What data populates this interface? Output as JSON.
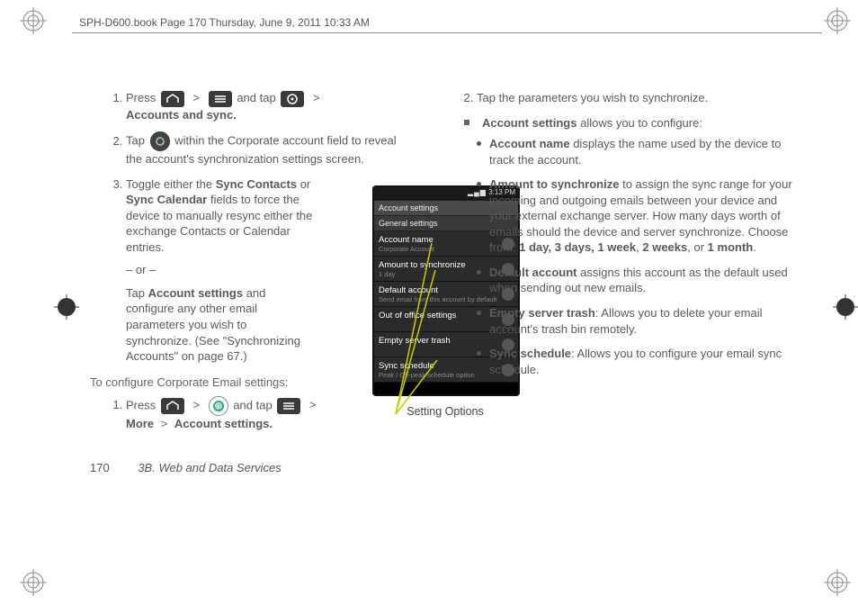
{
  "header": "SPH-D600.book  Page 170  Thursday, June 9, 2011  10:33 AM",
  "left": {
    "step1_a": "Press",
    "step1_b": "and tap",
    "step1_c": "Accounts and sync.",
    "step2_a": "Tap",
    "step2_b": "within the Corporate account field to reveal the account's synchronization settings screen.",
    "step3_a": "Toggle either the",
    "step3_sync_contacts": "Sync Contacts",
    "step3_or": "or",
    "step3_sync_calendar": "Sync Calendar",
    "step3_b": "fields to force the device to manually resync either the exchange Contacts or Calendar entries.",
    "or_sep": "– or –",
    "step3_c1": "Tap",
    "step3_acct_settings": "Account settings",
    "step3_c2": "and configure any other email parameters you wish to synchronize. (See \"Synchronizing Accounts\" on page 67.)",
    "subhead": "To configure Corporate Email settings:",
    "s1_a": "Press",
    "s1_b": "and tap",
    "s1_more": "More",
    "s1_gt": ">",
    "s1_acct": "Account settings."
  },
  "phone": {
    "status_time": "3:13 PM",
    "hdr1": "Account settings",
    "hdr2": "General settings",
    "rows": [
      {
        "t": "Account name",
        "s": "Corporate Account"
      },
      {
        "t": "Amount to synchronize",
        "s": "1 day"
      },
      {
        "t": "Default account",
        "s": "Send email from this account by default"
      },
      {
        "t": "Out of office settings",
        "s": ""
      },
      {
        "t": "Empty server trash",
        "s": ""
      },
      {
        "t": "Sync schedule",
        "s": "Peak / Off-peak schedule option"
      }
    ],
    "caption": "Setting Options"
  },
  "right": {
    "step2": "Tap the parameters you wish to synchronize.",
    "as_lead_b": "Account settings",
    "as_lead_t": "allows you to configure:",
    "items": {
      "acct_name_b": "Account name",
      "acct_name_t": "displays the name used by the device to track the account.",
      "amt_b": "Amount to synchronize",
      "amt_t1": "to assign the sync range for your incoming and outgoing emails between your device and your external exchange server. How many days worth of emails should the device and server synchronize. Choose from:",
      "amt_opts_a": "1 day, 3 days,",
      "amt_opts_b": "1 week",
      "amt_opts_c": "2 weeks",
      "amt_opts_or": ", or",
      "amt_opts_d": "1 month",
      "def_b": "Default account",
      "def_t": "assigns this account as the default used when sending out new emails.",
      "trash_b": "Empty server trash",
      "trash_t": ": Allows you to delete your email account's trash bin remotely.",
      "sched_b": "Sync schedule",
      "sched_t": ": Allows you to configure your email sync schedule."
    }
  },
  "footer": {
    "page": "170",
    "section": "3B. Web and Data Services"
  }
}
